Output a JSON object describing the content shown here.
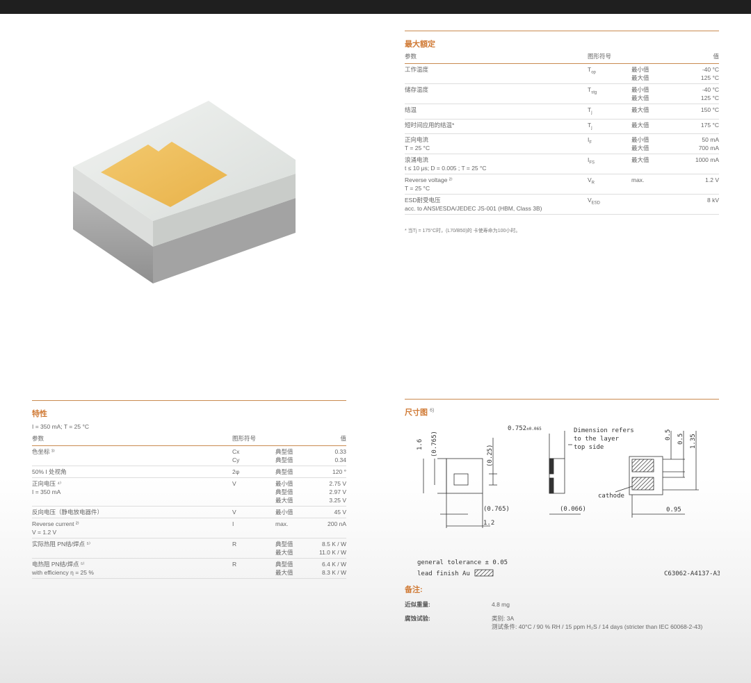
{
  "ratings": {
    "title": "最大額定",
    "headers": {
      "param": "参数",
      "symbol": "图形符号",
      "value": "值"
    },
    "rows": [
      {
        "param": [
          "工作温度"
        ],
        "symbol": "T",
        "symbol_sub": "op",
        "kind": [
          "最小值",
          "最大值"
        ],
        "value": [
          "-40 °C",
          "125 °C"
        ]
      },
      {
        "param": [
          "储存温度"
        ],
        "symbol": "T",
        "symbol_sub": "stg",
        "kind": [
          "最小值",
          "最大值"
        ],
        "value": [
          "-40 °C",
          "125 °C"
        ]
      },
      {
        "param": [
          "结温"
        ],
        "symbol": "T",
        "symbol_sub": "j",
        "kind": [
          "最大值"
        ],
        "value": [
          "150 °C"
        ]
      },
      {
        "param": [
          "短时间应用的结温*"
        ],
        "symbol": "T",
        "symbol_sub": "j",
        "kind": [
          "最大值"
        ],
        "value": [
          "175 °C"
        ]
      },
      {
        "param": [
          "正向电流",
          "T = 25 °C"
        ],
        "symbol": "I",
        "symbol_sub": "F",
        "kind": [
          "最小值",
          "最大值"
        ],
        "value": [
          "50 mA",
          "700 mA"
        ]
      },
      {
        "param": [
          "浪涌电流",
          "t ≤ 10 μs; D = 0.005 ; T = 25 °C"
        ],
        "symbol": "I",
        "symbol_sub": "FS",
        "kind": [
          "最大值"
        ],
        "value": [
          "1000 mA"
        ]
      },
      {
        "param": [
          "Reverse voltage ²⁾",
          "T = 25 °C"
        ],
        "symbol": "V",
        "symbol_sub": "R",
        "kind": [
          "max."
        ],
        "value": [
          "1.2 V"
        ]
      },
      {
        "param": [
          "ESD耐受电压",
          "acc. to ANSI/ESDA/JEDEC JS-001 (HBM, Class 3B)"
        ],
        "symbol": "V",
        "symbol_sub": "ESD",
        "kind": [
          ""
        ],
        "value": [
          "8 kV"
        ]
      }
    ],
    "footnote": "* 当Tj = 175°C时，(L70/B50)的 卡使寿命为100小时。"
  },
  "characteristics": {
    "title": "特性",
    "condition": "I = 350 mA; T = 25 °C",
    "headers": {
      "param": "参数",
      "symbol": "图形符号",
      "value": "值"
    },
    "rows": [
      {
        "param": [
          "色坐标 ³⁾"
        ],
        "symbol": [
          "Cx",
          "Cy"
        ],
        "kind": [
          "典型值",
          "典型值"
        ],
        "value": [
          "0.33",
          "0.34"
        ]
      },
      {
        "param": [
          "50% I 处视角"
        ],
        "symbol": [
          "2φ"
        ],
        "kind": [
          "典型值"
        ],
        "value": [
          "120 °"
        ]
      },
      {
        "param": [
          "正向电压 ⁴⁾",
          "I = 350 mA"
        ],
        "symbol": [
          "V"
        ],
        "kind": [
          "最小值",
          "典型值",
          "最大值"
        ],
        "value": [
          "2.75 V",
          "2.97 V",
          "3.25 V"
        ]
      },
      {
        "param": [
          "反向电压（静电放电器件）"
        ],
        "symbol": [
          "V"
        ],
        "kind": [
          "最小值"
        ],
        "value": [
          "45 V"
        ]
      },
      {
        "param": [
          "Reverse current ²⁾",
          "V = 1.2 V"
        ],
        "symbol": [
          "I"
        ],
        "kind": [
          "max."
        ],
        "value": [
          "200 nA"
        ]
      },
      {
        "param": [
          "实际热阻 PN结/焊点 ⁵⁾"
        ],
        "symbol": [
          "R"
        ],
        "kind": [
          "典型值",
          "最大值"
        ],
        "value": [
          "8.5 K / W",
          "11.0 K / W"
        ]
      },
      {
        "param": [
          "电热阻 PN结/焊点 ⁵⁾",
          "with efficiency η = 25 %"
        ],
        "symbol": [
          "R"
        ],
        "kind": [
          "典型值",
          "最大值"
        ],
        "value": [
          "6.4 K / W",
          "8.3 K / W"
        ]
      }
    ]
  },
  "dimensions": {
    "title": "尺寸图",
    "title_sup": "6)",
    "labels": {
      "d16": "1.6",
      "d0765a": "(0.765)",
      "d025": "(0.25)",
      "d0765b": "(0.765)",
      "d12": "1.2",
      "d0752": "0.752",
      "d0752tol": "±0.065",
      "d0066": "(0.066)",
      "dimnote": [
        "Dimension refers",
        "to the layer",
        "top side"
      ],
      "d05a": "0.5",
      "d05b": "0.5",
      "d135": "1.35",
      "d095": "0.95",
      "cathode": "cathode",
      "tolerance": "general tolerance ± 0.05",
      "lead": "lead finish Au",
      "code": "C63062-A4137-A3-03"
    }
  },
  "remarks": {
    "title": "备注:",
    "weight_label": "近似重量:",
    "weight_value": "4.8 mg",
    "corrosion_label": "腐蚀试验:",
    "corrosion_class": "类别: 3A",
    "corrosion_cond": "测试条件: 40°C / 90 % RH / 15 ppm H₂S / 14 days (stricter than IEC 60068-2-43)"
  }
}
